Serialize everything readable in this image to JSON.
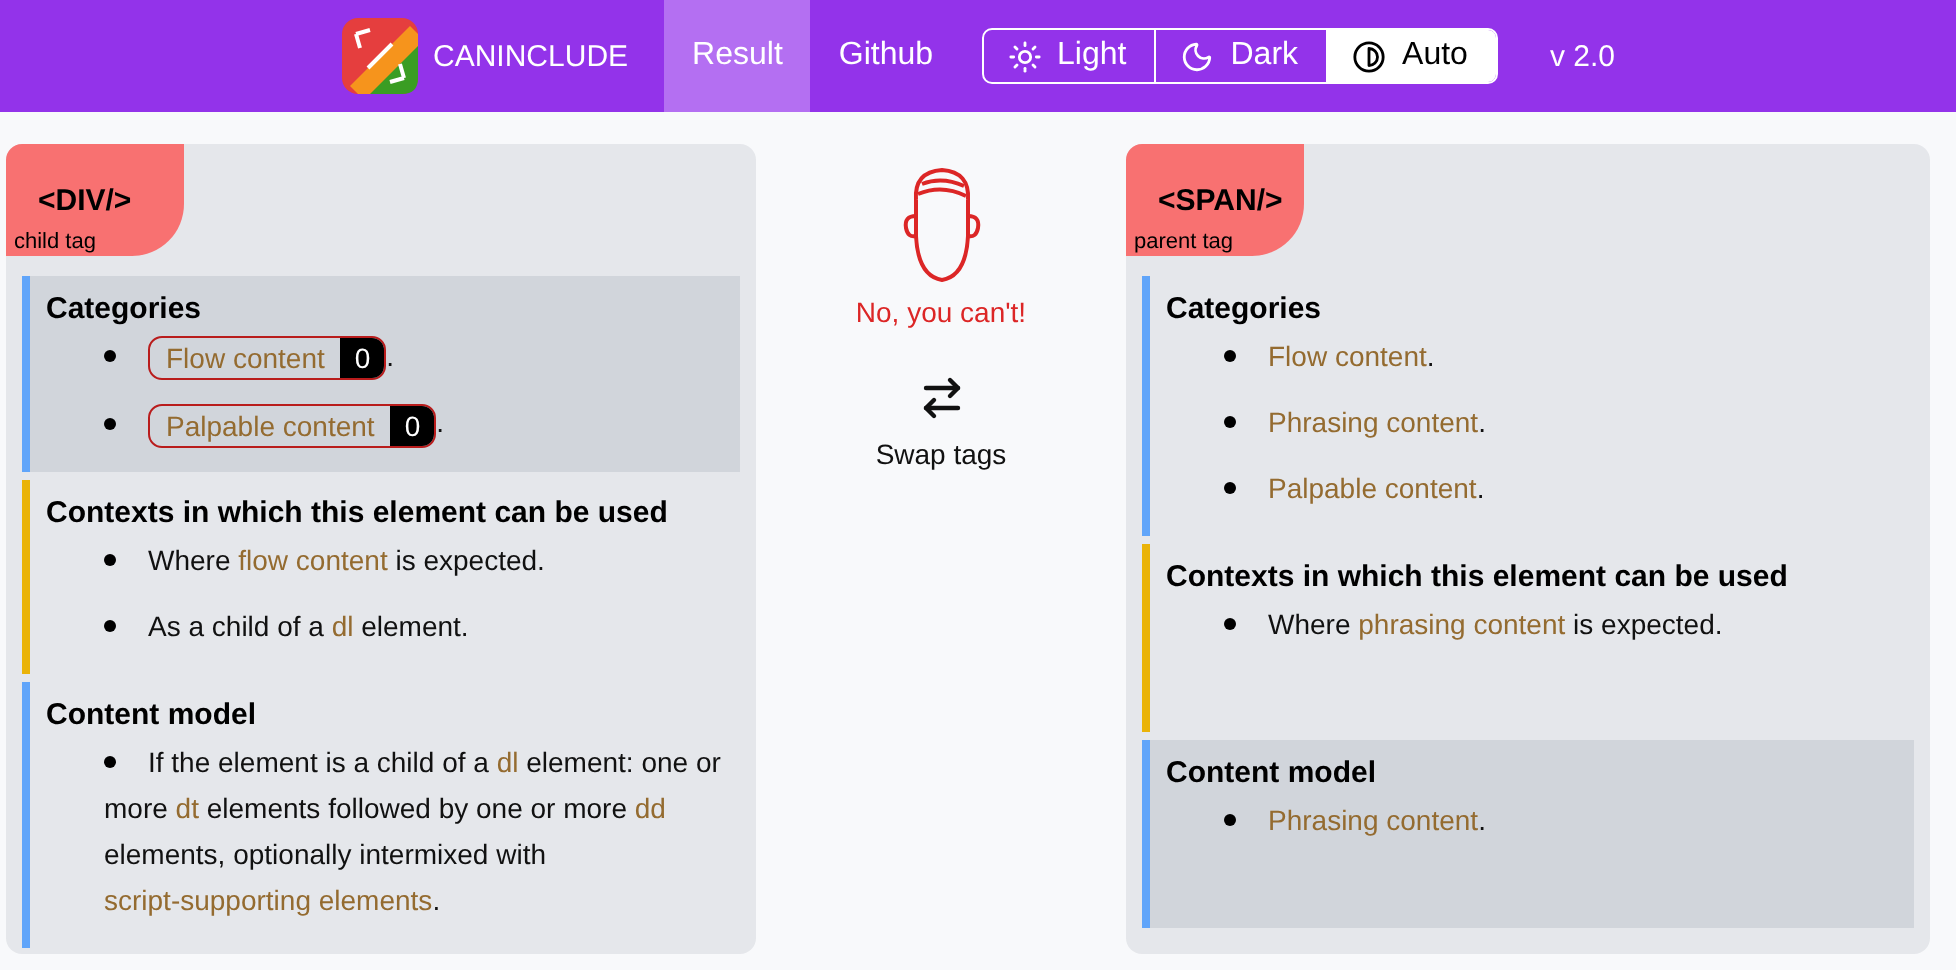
{
  "header": {
    "brand": "CANINCLUDE",
    "nav": [
      {
        "label": "Result",
        "selected": true
      },
      {
        "label": "Github",
        "selected": false
      }
    ],
    "theme": [
      {
        "label": "Light",
        "selected": false
      },
      {
        "label": "Dark",
        "selected": false
      },
      {
        "label": "Auto",
        "selected": true
      }
    ],
    "version": "v 2.0"
  },
  "panels": [
    {
      "tag": "<DIV/>",
      "role": "child tag",
      "sections": [
        {
          "title": "Categories",
          "color": "#60a5fa",
          "highlighted": true,
          "items": [
            [
              {
                "kind": "chip",
                "text": "Flow content",
                "count": "0"
              },
              {
                "kind": "text",
                "text": "."
              }
            ],
            [
              {
                "kind": "chip",
                "text": "Palpable content",
                "count": "0"
              },
              {
                "kind": "text",
                "text": "."
              }
            ]
          ]
        },
        {
          "title": "Contexts in which this element can be used",
          "color": "#eab308",
          "highlighted": false,
          "items": [
            [
              {
                "kind": "text",
                "text": "Where "
              },
              {
                "kind": "link",
                "text": "flow content"
              },
              {
                "kind": "text",
                "text": " is expected."
              }
            ],
            [
              {
                "kind": "text",
                "text": "As a child of a "
              },
              {
                "kind": "link",
                "text": "dl"
              },
              {
                "kind": "text",
                "text": " element."
              }
            ]
          ]
        },
        {
          "title": "Content model",
          "color": "#60a5fa",
          "highlighted": false,
          "items": [
            [
              {
                "kind": "text",
                "text": "If the element is a child of a "
              },
              {
                "kind": "link",
                "text": "dl"
              },
              {
                "kind": "text",
                "text": " element: one or more "
              },
              {
                "kind": "link",
                "text": "dt"
              },
              {
                "kind": "text",
                "text": " elements followed by one or more "
              },
              {
                "kind": "link",
                "text": "dd"
              },
              {
                "kind": "text",
                "text": " elements, optionally intermixed with "
              },
              {
                "kind": "link",
                "text": "script-supporting elements"
              },
              {
                "kind": "text",
                "text": "."
              }
            ]
          ]
        }
      ]
    },
    {
      "tag": "<SPAN/>",
      "role": "parent tag",
      "sections": [
        {
          "title": "Categories",
          "color": "#60a5fa",
          "highlighted": false,
          "items": [
            [
              {
                "kind": "link",
                "text": "Flow content"
              },
              {
                "kind": "text",
                "text": "."
              }
            ],
            [
              {
                "kind": "link",
                "text": "Phrasing content"
              },
              {
                "kind": "text",
                "text": "."
              }
            ],
            [
              {
                "kind": "link",
                "text": "Palpable content"
              },
              {
                "kind": "text",
                "text": "."
              }
            ]
          ]
        },
        {
          "title": "Contexts in which this element can be used",
          "color": "#eab308",
          "highlighted": false,
          "items": [
            [
              {
                "kind": "text",
                "text": "Where "
              },
              {
                "kind": "link",
                "text": "phrasing content"
              },
              {
                "kind": "text",
                "text": " is expected."
              }
            ]
          ]
        },
        {
          "title": "Content model",
          "color": "#60a5fa",
          "highlighted": true,
          "items": [
            [
              {
                "kind": "link",
                "text": "Phrasing content"
              },
              {
                "kind": "text",
                "text": "."
              }
            ]
          ]
        }
      ]
    }
  ],
  "verdict": {
    "message": "No, you can't!",
    "swap": "Swap tags"
  }
}
